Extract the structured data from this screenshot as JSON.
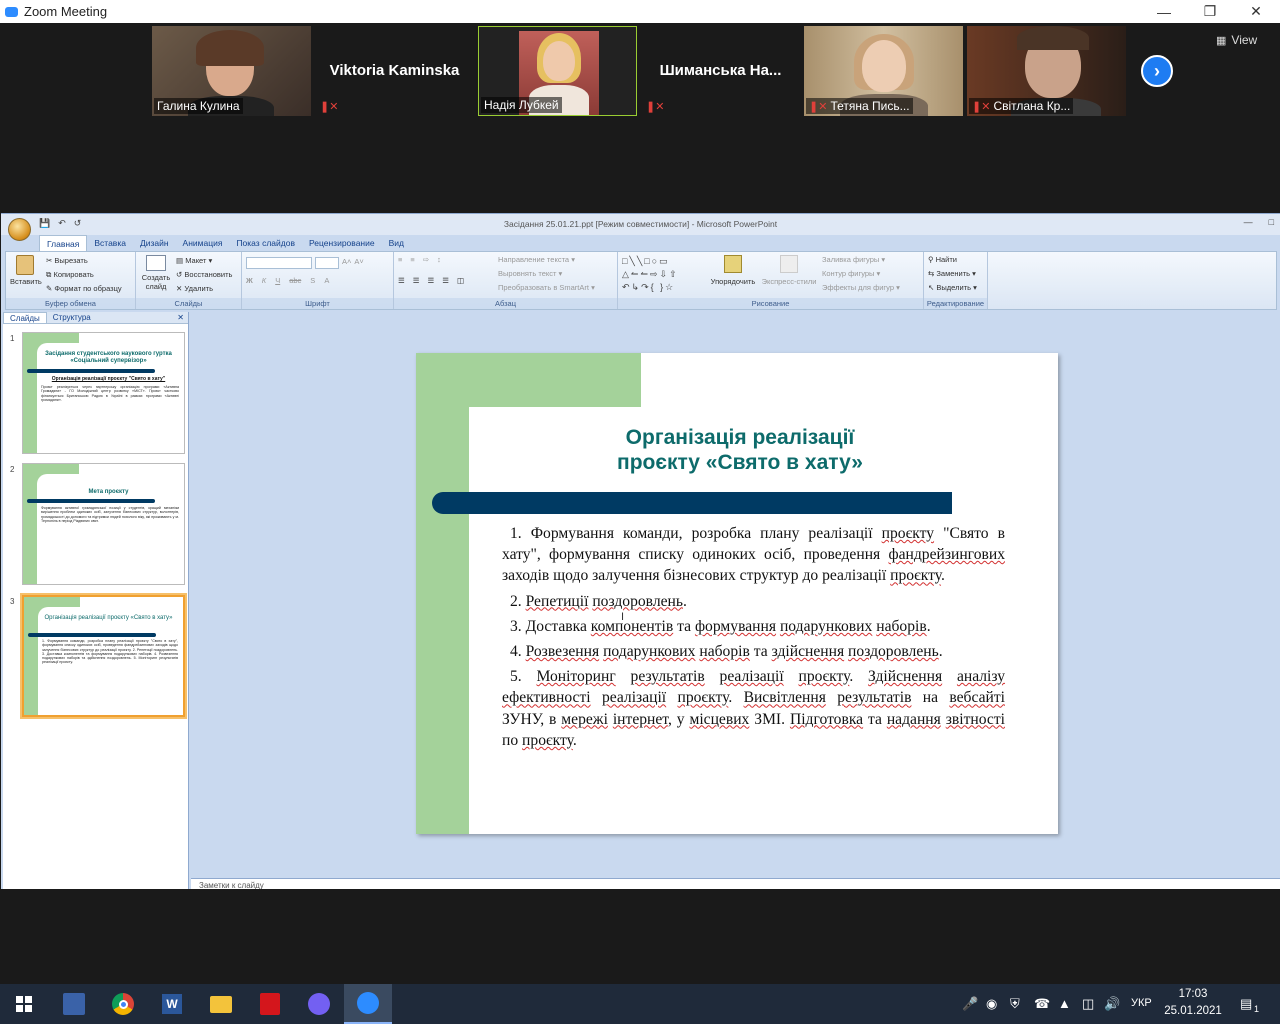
{
  "zoom": {
    "window_title": "Zoom Meeting",
    "view_label": "View",
    "participants": [
      {
        "name": "Галина Кулина",
        "has_video": true,
        "muted": false
      },
      {
        "name": "Viktoria Kaminska",
        "has_video": false,
        "muted": true
      },
      {
        "name": "Надія Лубкей",
        "has_video": true,
        "muted": false,
        "active_speaker": true
      },
      {
        "name": "Шиманська  На...",
        "has_video": false,
        "muted": true
      },
      {
        "name": "Тетяна Пись...",
        "has_video": true,
        "muted": true
      },
      {
        "name": "Світлана Кр...",
        "has_video": true,
        "muted": true
      }
    ]
  },
  "ppt": {
    "window_title": "Засідання 25.01.21.ppt [Режим совместимости] - Microsoft PowerPoint",
    "tabs": [
      "Главная",
      "Вставка",
      "Дизайн",
      "Анимация",
      "Показ слайдов",
      "Рецензирование",
      "Вид"
    ],
    "ribbon": {
      "clipboard": {
        "paste": "Вставить",
        "cut": "Вырезать",
        "copy": "Копировать",
        "format": "Формат по образцу",
        "label": "Буфер обмена"
      },
      "slides": {
        "create": "Создать слайд",
        "layout": "Макет",
        "reset": "Восстановить",
        "delete": "Удалить",
        "label": "Слайды"
      },
      "font": {
        "label": "Шрифт"
      },
      "paragraph": {
        "dir": "Направление текста",
        "align": "Выровнять текст",
        "smartart": "Преобразовать в SmartArt",
        "label": "Абзац"
      },
      "drawing": {
        "arrange": "Упорядочить",
        "express": "Экспресс-стили",
        "fill": "Заливка фигуры",
        "outline": "Контур фигуры",
        "effects": "Эффекты для фигур",
        "label": "Рисование"
      },
      "editing": {
        "find": "Найти",
        "replace": "Заменить",
        "select": "Выделить",
        "label": "Редактирование"
      }
    },
    "panel_tabs": [
      "Слайды",
      "Структура"
    ],
    "notes_placeholder": "Заметки к слайду",
    "thumbnails": [
      {
        "num": "1",
        "title": "Засідання студентського наукового гуртка «Соціальний супервізор»",
        "subtitle": "Організація реалізації проєкту \"Свято в хату\"",
        "text": "Проєкт реалізується через партнерську організацію програми «Активна Громадяни» - ГО Молодіжний центр розвитку «МІСТ». Проєкт частково фінансується Британською Радою в Україні в рамках програми «Активні громадяни»."
      },
      {
        "num": "2",
        "title": "Мета проєкту",
        "text": "Формування активної громадянської позиції у студентів, кращий механізм вирішення проблем одиноких осіб, залучення бізнесових структур, волонтерів, громадськості до допомоги та підтримки людей похилого віку, які проживають у м. Тернопіль в період Різдвяних свят."
      },
      {
        "num": "3",
        "title": "Організація реалізації проєкту «Свято в хату»",
        "text": "1. Формування команди, розробка плану реалізації проєкту \"Свято в хату\", формування списку одиноких осіб, проведення фандрейзингових заходів щодо залучення бізнесових структур до реалізації проєкту. 2. Репетиції поздоровлень. 3. Доставка компонентів та формування подарункових наборів. 4. Розвезення подарункових наборів та здійснення поздоровлень. 5. Моніторинг результатів реалізації проєкту."
      }
    ],
    "slide": {
      "title_line1": "Організація реалізації",
      "title_line2": "проєкту «Свято в хату»"
    }
  },
  "taskbar": {
    "lang": "УКР",
    "time": "17:03",
    "date": "25.01.2021",
    "notifications": "1"
  }
}
